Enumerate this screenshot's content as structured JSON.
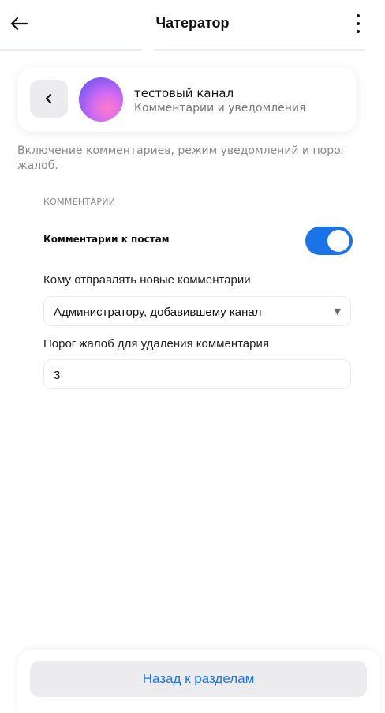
{
  "appbar": {
    "title": "Чатератор",
    "back_icon": "arrow-left-icon",
    "more_icon": "more-vertical-icon"
  },
  "channel": {
    "name": "тестовый канал",
    "subtitle": "Комментарии и уведомления",
    "back_icon": "chevron-left-icon"
  },
  "description": "Включение комментариев, режим уведомлений и порог жалоб.",
  "comments_section": {
    "heading": "КОММЕНТАРИИ",
    "toggle_label": "Комментарии к постам",
    "toggle_on": true,
    "recipient_label": "Кому отправлять новые комментарии",
    "recipient_value": "Администратору, добавившему канал",
    "threshold_label": "Порог жалоб для удаления комментария",
    "threshold_value": "3"
  },
  "footer": {
    "back_button_label": "Назад к разделам"
  },
  "colors": {
    "accent": "#1a73e8",
    "muted_text": "#888888",
    "button_bg": "#ececee"
  }
}
